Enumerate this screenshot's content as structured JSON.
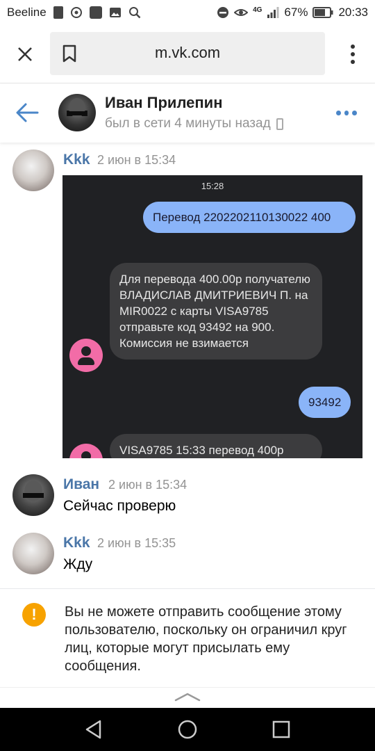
{
  "status_bar": {
    "carrier": "Beeline",
    "network": "4G",
    "battery": "67%",
    "time": "20:33"
  },
  "browser": {
    "url": "m.vk.com",
    "icons": [
      "close-icon",
      "bookmark-icon",
      "more-vertical-icon"
    ]
  },
  "chat_header": {
    "name": "Иван Прилепин",
    "status": "был в сети 4 минуты назад"
  },
  "messages": [
    {
      "author": "Kkk",
      "date": "2 июн в 15:34"
    },
    {
      "author": "Иван",
      "date": "2 июн в 15:34",
      "text": "Сейчас проверю"
    },
    {
      "author": "Kkk",
      "date": "2 июн в 15:35",
      "text": "Жду"
    }
  ],
  "screenshot": {
    "time": "15:28",
    "out_1": "Перевод 2202202110130022 400",
    "in_1": "Для перевода 400.00р получателю ВЛАДИСЛАВ ДМИТРИЕВИЧ П. на MIR0022 с карты VISA9785 отправьте код 93492 на 900. Комиссия не взимается",
    "out_2": "93492",
    "in_2": "VISA9785 15:33 перевод 400р"
  },
  "notice": {
    "text": "Вы не можете отправить сообщение этому пользователю, поскольку он ограничил круг лиц, которые могут присылать ему сообщения."
  },
  "colors": {
    "vk_blue": "#4a76a8",
    "accent": "#4a86c8",
    "warning": "#f7a200",
    "bubble_out": "#8ab4f8",
    "bubble_in": "#3c3c3e",
    "contact_avatar": "#f26ca7"
  }
}
